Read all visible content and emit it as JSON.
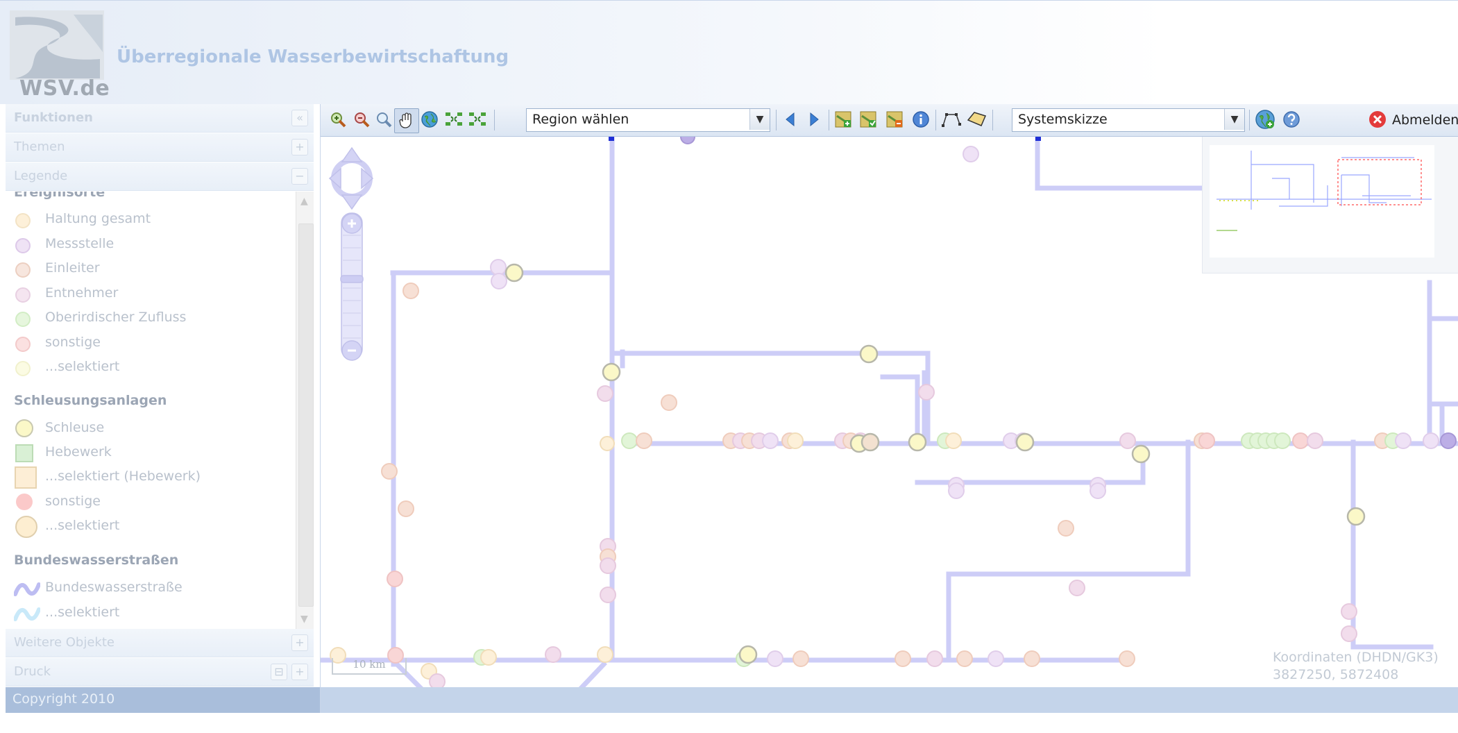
{
  "header": {
    "logo_text": "WSV.de",
    "title": "Überregionale Wasserbewirtschaftung"
  },
  "sidebar": {
    "panels": [
      {
        "title": "Funktionen",
        "button": "«"
      },
      {
        "title": "Themen",
        "button": "+"
      },
      {
        "title": "Legende",
        "button": "−"
      }
    ],
    "legend": {
      "sections": [
        {
          "title": "Ereignisorte",
          "items": [
            "Haltung gesamt",
            "Messstelle",
            "Einleiter",
            "Entnehmer",
            "Oberirdischer Zufluss",
            "sonstige",
            "...selektiert"
          ]
        },
        {
          "title": "Schleusungsanlagen",
          "items": [
            "Schleuse",
            "Hebewerk",
            "...selektiert (Hebewerk)",
            "sonstige",
            "...selektiert"
          ]
        },
        {
          "title": "Bundeswasserstraßen",
          "items": [
            "Bundeswasserstraße",
            "...selektiert"
          ]
        }
      ]
    },
    "bottom_panels": [
      {
        "title": "Weitere Objekte",
        "button": "+"
      },
      {
        "title": "Druck",
        "button": "+"
      }
    ],
    "copyright": "Copyright 2010"
  },
  "toolbar": {
    "icons": [
      "zoom-in-icon",
      "zoom-out-icon",
      "zoom-box-icon",
      "pan-hand-icon",
      "globe-full-extent-icon",
      "expand-icon",
      "collapse-icon"
    ],
    "region_select": {
      "value": "Region wählen"
    },
    "nav": [
      "back-arrow-icon",
      "forward-arrow-icon"
    ],
    "layer_icons": [
      "layer-add-icon",
      "layer-edit-icon",
      "layer-remove-icon",
      "info-icon"
    ],
    "measure_icons": [
      "measure-line-icon",
      "measure-area-icon"
    ],
    "view_select": {
      "value": "Systemskizze"
    },
    "extra_icons": [
      "globe-link-icon",
      "help-icon"
    ],
    "logout_label": "Abmelden"
  },
  "map": {
    "coords_label": "Koordinaten (DHDN/GK3)",
    "coords_value": "3827250, 5872408",
    "scale_label": "10 km",
    "colors": {
      "waterway": "#cdcdf7",
      "lock": "#fbf8c8",
      "lock_stroke": "#b7b7b7",
      "messstelle": "#e8d8f0",
      "einleiter": "#f7e0d5",
      "entnehmer": "#f2ddec",
      "zufluss": "#e2f5d8",
      "sonstige": "#f9d6d6",
      "haltung": "#fdf0d9"
    }
  }
}
